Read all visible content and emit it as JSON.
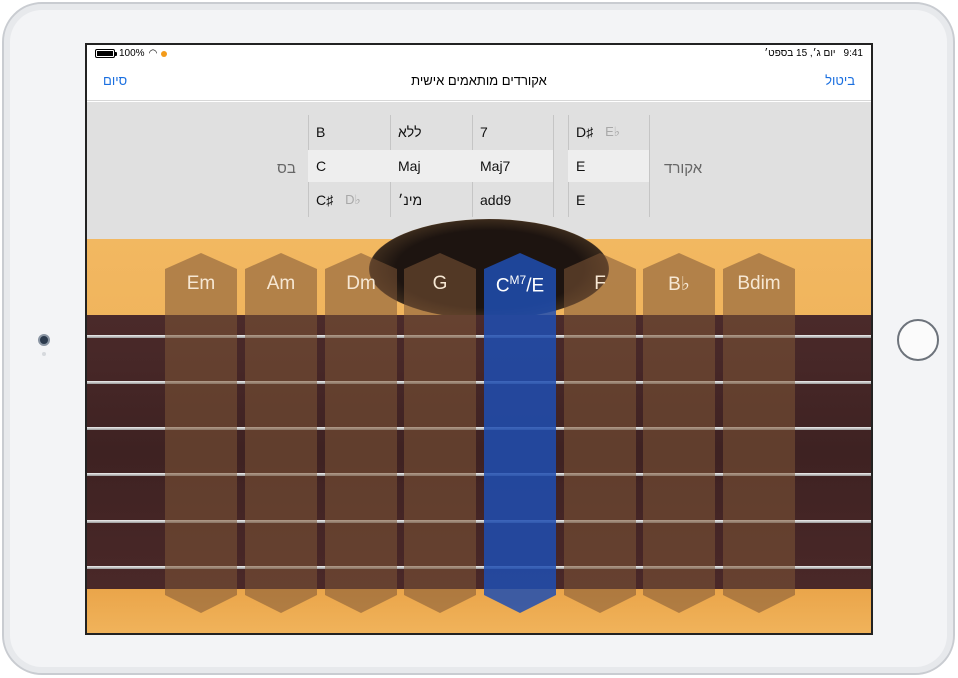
{
  "status_bar": {
    "battery": "100%",
    "time": "9:41",
    "date": "יום ג׳, 15 בספט׳"
  },
  "nav": {
    "title": "אקורדים מותאמים אישית",
    "done": "סיום",
    "cancel": "ביטול"
  },
  "picker": {
    "bass_label": "בס",
    "chord_label": "אקורד",
    "bass_column": {
      "top": "B",
      "selected": "C",
      "bottom": "C♯",
      "bottom_alt": "D♭"
    },
    "quality_column": {
      "top": "ללא",
      "selected": "Maj",
      "bottom": "מינ׳"
    },
    "extension_column": {
      "top": "7",
      "selected": "Maj7",
      "bottom": "add9"
    },
    "root_column": {
      "top": "D♯",
      "top_alt": "E♭",
      "selected": "E",
      "bottom": "E"
    }
  },
  "chords": [
    {
      "label": "Em"
    },
    {
      "label": "Am"
    },
    {
      "label": "Dm"
    },
    {
      "label": "G"
    },
    {
      "label_base": "C",
      "label_sup": "M7",
      "label_tail": "/E",
      "active": true
    },
    {
      "label": "F"
    },
    {
      "label": "B♭"
    },
    {
      "label": "Bdim"
    }
  ],
  "colors": {
    "accent": "#1a6fe0",
    "active_chord": "#1e4eb2",
    "guitar_wood": "#eaa64c"
  }
}
